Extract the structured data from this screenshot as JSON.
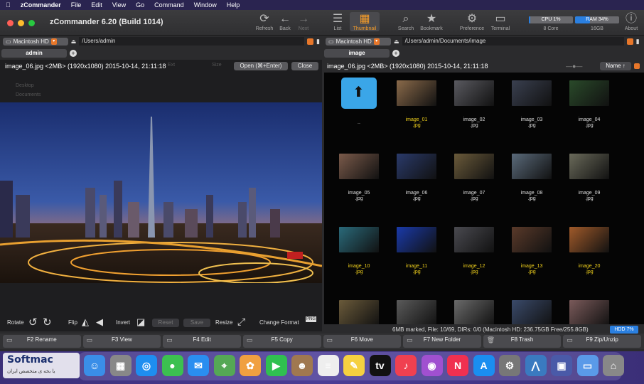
{
  "menubar": {
    "apple": "",
    "app": "zCommander",
    "items": [
      "File",
      "Edit",
      "View",
      "Go",
      "Command",
      "Window",
      "Help"
    ]
  },
  "window": {
    "title": "zCommander 6.20 (Build 1014)"
  },
  "toolbar": {
    "refresh": "Refresh",
    "back": "Back",
    "next": "Next",
    "list": "List",
    "thumbnail": "Thumbnail",
    "search": "Search",
    "bookmark": "Bookmark",
    "preference": "Preference",
    "terminal": "Terminal",
    "about": "About",
    "cpu_label": "CPU 1%",
    "cpu_sub": "8 Core",
    "cpu_level": 0.01,
    "ram_label": "RAM 34%",
    "ram_sub": "16GB",
    "ram_level": 0.34
  },
  "left": {
    "drive": "Macintosh HD",
    "path": "/Users/admin",
    "tab": "admin",
    "preview_title": "image_06.jpg <2MB> (1920x1080) 2015-10-14, 21:11:18",
    "open_btn": "Open (⌘+Enter)",
    "close_btn": "Close",
    "ghost_cols": [
      "Ext",
      "Size"
    ],
    "ghost_rows": [
      "Desktop",
      "Documents"
    ],
    "controls": {
      "rotate": "Rotate",
      "flip": "Flip",
      "invert": "Invert",
      "reset": "Reset",
      "save": "Save",
      "resize": "Resize",
      "change_format": "Change Format",
      "png": "PNG"
    }
  },
  "right": {
    "drive": "Macintosh HD",
    "path": "/Users/admin/Documents/image",
    "tab": "image",
    "info": "image_06.jpg <2MB> (1920x1080) 2015-10-14, 21:11:18",
    "sort": "Name ↑",
    "parent": "..",
    "files": [
      {
        "name": "image_01",
        "ext": ".jpg",
        "marked": true,
        "color": "#8a6a4a"
      },
      {
        "name": "image_02",
        "ext": ".jpg",
        "marked": false,
        "color": "#5a5a60"
      },
      {
        "name": "image_03",
        "ext": ".jpg",
        "marked": false,
        "color": "#3a4050"
      },
      {
        "name": "image_04",
        "ext": ".jpg",
        "marked": false,
        "color": "#2a4a2a"
      },
      {
        "name": "image_05",
        "ext": ".jpg",
        "marked": false,
        "color": "#7a5a4a"
      },
      {
        "name": "image_06",
        "ext": ".jpg",
        "marked": false,
        "color": "#2a3a6a"
      },
      {
        "name": "image_07",
        "ext": ".jpg",
        "marked": false,
        "color": "#6a5a3a"
      },
      {
        "name": "image_08",
        "ext": ".jpg",
        "marked": false,
        "color": "#5a6a7a"
      },
      {
        "name": "image_09",
        "ext": ".jpg",
        "marked": false,
        "color": "#6a6a5a"
      },
      {
        "name": "image_10",
        "ext": ".jpg",
        "marked": true,
        "color": "#2a6a7a"
      },
      {
        "name": "image_11",
        "ext": ".jpg",
        "marked": true,
        "color": "#1a3aaa"
      },
      {
        "name": "image_12",
        "ext": ".jpg",
        "marked": true,
        "color": "#4a4a50"
      },
      {
        "name": "image_13",
        "ext": ".jpg",
        "marked": true,
        "color": "#5a3a2a"
      },
      {
        "name": "image_20",
        "ext": ".jpg",
        "marked": true,
        "color": "#a05a2a"
      },
      {
        "name": "",
        "ext": "",
        "marked": false,
        "color": "#6a5a3a"
      },
      {
        "name": "",
        "ext": "",
        "marked": false,
        "color": "#5a5a5a"
      },
      {
        "name": "",
        "ext": "",
        "marked": false,
        "color": "#6a6a6a"
      },
      {
        "name": "",
        "ext": "",
        "marked": false,
        "color": "#3a4a6a"
      },
      {
        "name": "",
        "ext": "",
        "marked": false,
        "color": "#7a5a5a"
      }
    ],
    "status": "6MB marked, File: 10/69, DIRs: 0/0  (Macintosh HD: 236.75GB Free/255.8GB)",
    "hdd": "HDD 7%"
  },
  "fkeys": [
    "F2 Rename",
    "F3 View",
    "F4 Edit",
    "F5 Copy",
    "F6 Move",
    "F7 New Folder",
    "F8 Trash",
    "F9 Zip/Unzip"
  ],
  "watermark": {
    "brand": "Softmac",
    "tagline": "یا بخه ی متخصص ایران"
  },
  "dock": [
    "Finder",
    "Launchpad",
    "Safari",
    "Messages",
    "Mail",
    "Maps",
    "Photos",
    "FaceTime",
    "Contacts",
    "Reminders",
    "Notes",
    "TV",
    "Music",
    "Podcasts",
    "News",
    "App Store",
    "System Preferences",
    "zCommander",
    "Save",
    "Downloads",
    "Trash"
  ]
}
